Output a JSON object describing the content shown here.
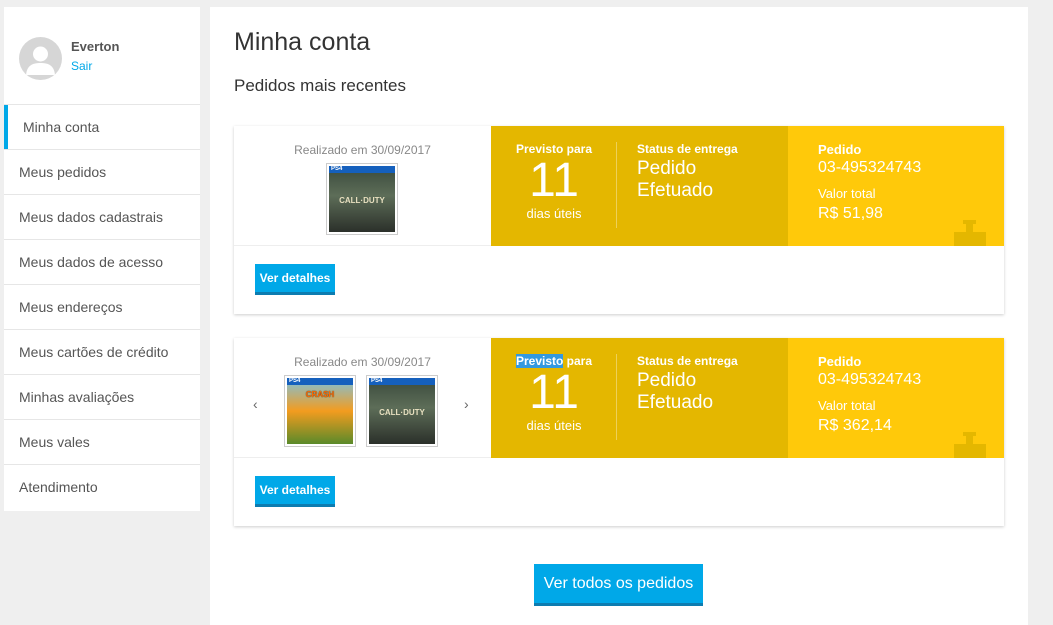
{
  "user": {
    "name": "Everton",
    "logout_label": "Sair"
  },
  "nav": {
    "items": [
      {
        "label": "Minha conta"
      },
      {
        "label": "Meus pedidos"
      },
      {
        "label": "Meus dados cadastrais"
      },
      {
        "label": "Meus dados de acesso"
      },
      {
        "label": "Meus endereços"
      },
      {
        "label": "Meus cartões de crédito"
      },
      {
        "label": "Minhas avaliações"
      },
      {
        "label": "Meus vales"
      },
      {
        "label": "Atendimento"
      }
    ],
    "active": "Minha conta"
  },
  "main": {
    "title": "Minha conta",
    "section_title": "Pedidos mais recentes",
    "all_orders_label": "Ver todos os pedidos"
  },
  "orders": [
    {
      "date_text": "Realizado em 30/09/2017",
      "forecast_label": "Previsto para",
      "forecast_number": "11",
      "forecast_unit": "dias úteis",
      "status_label": "Status de entrega",
      "status_value": "Pedido Efetuado",
      "order_label": "Pedido",
      "order_number": "03-495324743",
      "total_label": "Valor total",
      "total_value": "R$ 51,98",
      "details_label": "Ver detalhes",
      "products": [
        {
          "platform": "PS4",
          "title": "CALL·DUTY"
        }
      ]
    },
    {
      "date_text": "Realizado em 30/09/2017",
      "forecast_label_highlight": "Previsto",
      "forecast_label_rest": " para",
      "forecast_number": "11",
      "forecast_unit": "dias úteis",
      "status_label": "Status de entrega",
      "status_value": "Pedido Efetuado",
      "order_label": "Pedido",
      "order_number": "03-495324743",
      "total_label": "Valor total",
      "total_value": "R$ 362,14",
      "details_label": "Ver detalhes",
      "prev_arrow": "‹",
      "next_arrow": "›",
      "products": [
        {
          "platform": "PS4",
          "title": "CRASH"
        },
        {
          "platform": "PS4",
          "title": "CALL·DUTY"
        }
      ]
    }
  ],
  "colors": {
    "accent": "#00a8e8",
    "status_dark_yellow": "#e4b700",
    "status_yellow": "#ffc90a"
  },
  "icons": [
    "user-avatar-icon",
    "package-icon",
    "chevron-left-icon",
    "chevron-right-icon"
  ]
}
